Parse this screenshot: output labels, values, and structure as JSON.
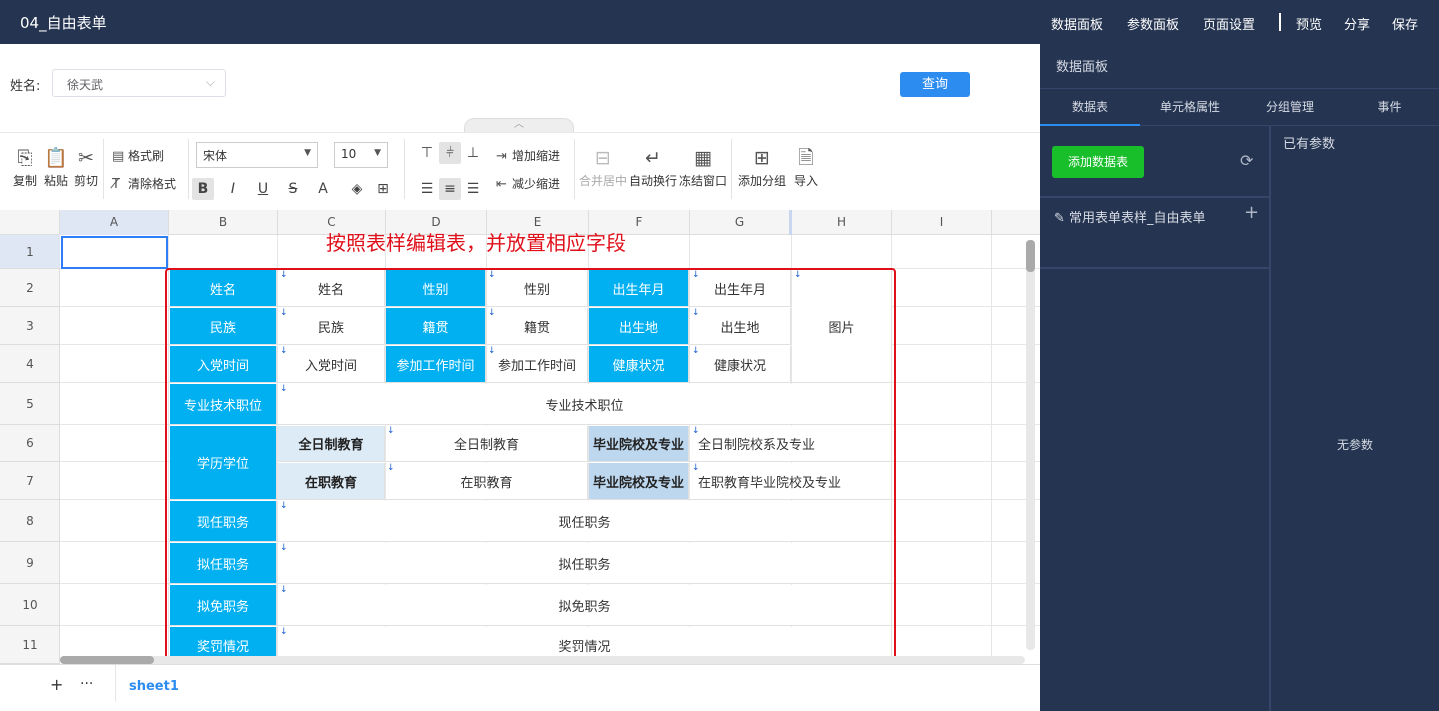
{
  "app": {
    "title": "04_自由表单"
  },
  "topnav": {
    "items": [
      "数据面板",
      "参数面板",
      "页面设置",
      "预览",
      "分享",
      "保存"
    ]
  },
  "filter": {
    "label": "姓名:",
    "value": "徐天武",
    "query_button": "查询"
  },
  "toolbar": {
    "copy": "复制",
    "paste": "粘贴",
    "cut": "剪切",
    "format_painter": "格式刷",
    "clear_format": "清除格式",
    "font": "宋体",
    "font_size": "10",
    "increase_indent": "增加缩进",
    "decrease_indent": "减少缩进",
    "merge_center": "合并居中",
    "auto_wrap": "自动换行",
    "freeze": "冻结窗口",
    "add_group": "添加分组",
    "import": "导入"
  },
  "sheet": {
    "columns": [
      "A",
      "B",
      "C",
      "D",
      "E",
      "F",
      "G",
      "H",
      "I"
    ],
    "rows": [
      "1",
      "2",
      "3",
      "4",
      "5",
      "6",
      "7",
      "8",
      "9",
      "10",
      "11"
    ],
    "annotation": "按照表样编辑表，并放置相应字段",
    "cells": {
      "name_label": "姓名",
      "name_value": "姓名",
      "gender_label": "性别",
      "gender_value": "性别",
      "birth_label": "出生年月",
      "birth_value": "出生年月",
      "photo": "图片",
      "ethnic_label": "民族",
      "ethnic_value": "民族",
      "native_label": "籍贯",
      "native_value": "籍贯",
      "birthplace_label": "出生地",
      "birthplace_value": "出生地",
      "party_label": "入党时间",
      "party_value": "入党时间",
      "work_label": "参加工作时间",
      "work_value": "参加工作时间",
      "health_label": "健康状况",
      "health_value": "健康状况",
      "title_label": "专业技术职位",
      "title_value": "专业技术职位",
      "edu_label": "学历学位",
      "fulltime_label": "全日制教育",
      "fulltime_value": "全日制教育",
      "fulltime_school_label": "毕业院校及专业",
      "fulltime_school_value": "全日制院校系及专业",
      "inservice_label": "在职教育",
      "inservice_value": "在职教育",
      "inservice_school_label": "毕业院校及专业",
      "inservice_school_value": "在职教育毕业院校及专业",
      "current_label": "现任职务",
      "current_value": "现任职务",
      "proposed_label": "拟任职务",
      "proposed_value": "拟任职务",
      "removal_label": "拟免职务",
      "removal_value": "拟免职务",
      "reward_label": "奖罚情况",
      "reward_value": "奖罚情况"
    }
  },
  "tabs": {
    "sheet_name": "sheet1"
  },
  "panel": {
    "title": "数据面板",
    "tabs": [
      "数据表",
      "单元格属性",
      "分组管理",
      "事件"
    ],
    "add_dataset": "添加数据表",
    "dataset_item": "常用表单表样_自由表单",
    "params_title": "已有参数",
    "no_params": "无参数"
  },
  "colors": {
    "topbar": "#253451",
    "label_cell": "#00b0f0",
    "accent": "#2d8cf0",
    "add_button": "#19be2b",
    "selection": "#e0101b"
  }
}
